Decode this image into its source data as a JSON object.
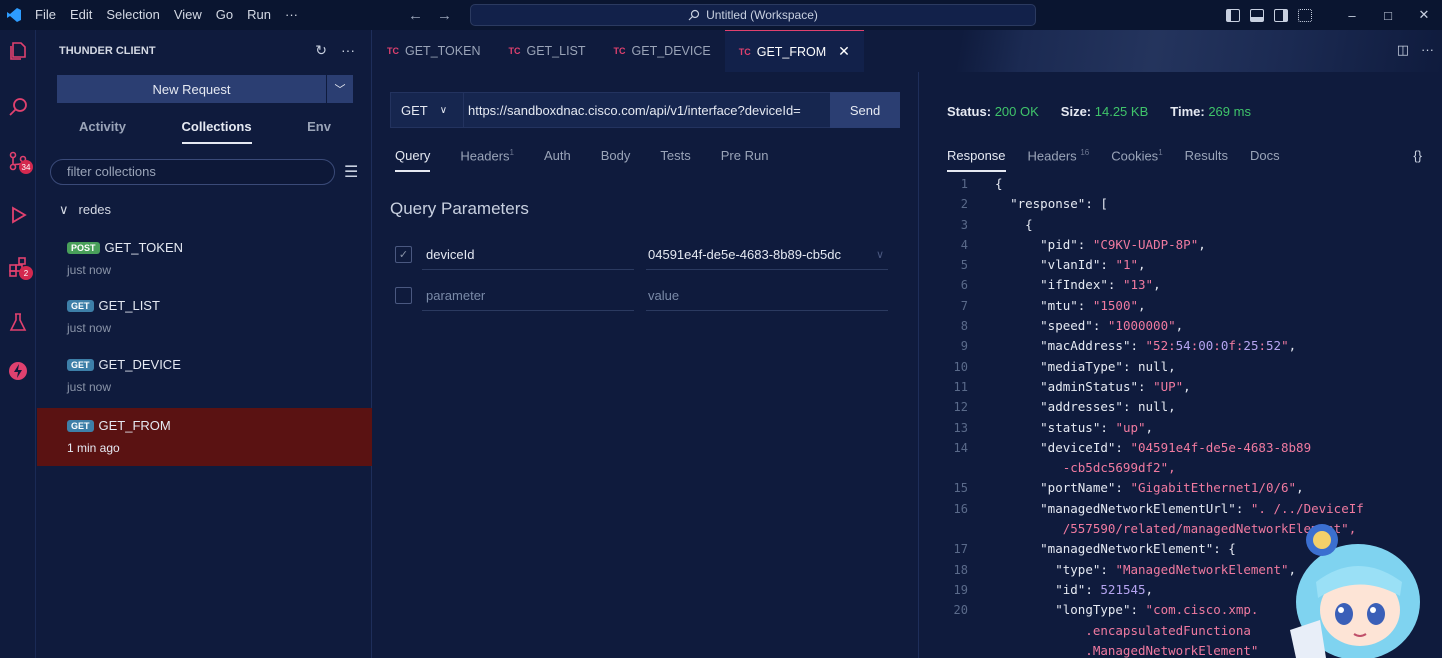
{
  "titlebar": {
    "menu": [
      "File",
      "Edit",
      "Selection",
      "View",
      "Go",
      "Run",
      "···"
    ],
    "command_center": "Untitled (Workspace)",
    "window_buttons": [
      "–",
      "□",
      "✕"
    ]
  },
  "activity_badges": {
    "source_control": "34",
    "extensions": "2"
  },
  "sidebar": {
    "title": "THUNDER CLIENT",
    "new_request": "New Request",
    "tabs": [
      "Activity",
      "Collections",
      "Env"
    ],
    "active_tab": "Collections",
    "filter_placeholder": "filter collections",
    "folder": "redes",
    "requests": [
      {
        "method": "POST",
        "name": "GET_TOKEN",
        "time": "just now"
      },
      {
        "method": "GET",
        "name": "GET_LIST",
        "time": "just now"
      },
      {
        "method": "GET",
        "name": "GET_DEVICE",
        "time": "just now"
      },
      {
        "method": "GET",
        "name": "GET_FROM",
        "time": "1 min ago"
      }
    ]
  },
  "editor_tabs": [
    {
      "prefix": "TC",
      "label": "GET_TOKEN"
    },
    {
      "prefix": "TC",
      "label": "GET_LIST"
    },
    {
      "prefix": "TC",
      "label": "GET_DEVICE"
    },
    {
      "prefix": "TC",
      "label": "GET_FROM"
    }
  ],
  "request": {
    "method": "GET",
    "url": "https://sandboxdnac.cisco.com/api/v1/interface?deviceId=",
    "send_label": "Send",
    "tabs": [
      {
        "label": "Query",
        "count": ""
      },
      {
        "label": "Headers",
        "count": "1"
      },
      {
        "label": "Auth",
        "count": ""
      },
      {
        "label": "Body",
        "count": ""
      },
      {
        "label": "Tests",
        "count": ""
      },
      {
        "label": "Pre Run",
        "count": ""
      }
    ],
    "query_title": "Query Parameters",
    "params": [
      {
        "key": "deviceId",
        "value": "04591e4f-de5e-4683-8b89-cb5dc",
        "checked": true
      },
      {
        "key_placeholder": "parameter",
        "value_placeholder": "value",
        "checked": false
      }
    ]
  },
  "response": {
    "status_label": "Status:",
    "status": "200 OK",
    "size_label": "Size:",
    "size": "14.25 KB",
    "time_label": "Time:",
    "time": "269 ms",
    "tabs": [
      {
        "label": "Response",
        "count": ""
      },
      {
        "label": "Headers",
        "count": "16"
      },
      {
        "label": "Cookies",
        "count": "1"
      },
      {
        "label": "Results",
        "count": ""
      },
      {
        "label": "Docs",
        "count": ""
      }
    ],
    "braces": "{}",
    "lines": [
      {
        "n": "1",
        "text": "{"
      },
      {
        "n": "2",
        "text": "  \"response\": ["
      },
      {
        "n": "3",
        "text": "    {"
      },
      {
        "n": "4",
        "text": "      \"pid\": \"C9KV-UADP-8P\","
      },
      {
        "n": "5",
        "text": "      \"vlanId\": \"1\","
      },
      {
        "n": "6",
        "text": "      \"ifIndex\": \"13\","
      },
      {
        "n": "7",
        "text": "      \"mtu\": \"1500\","
      },
      {
        "n": "8",
        "text": "      \"speed\": \"1000000\","
      },
      {
        "n": "9",
        "text": "      \"macAddress\": \"52:54:00:0f:25:52\","
      },
      {
        "n": "10",
        "text": "      \"mediaType\": null,"
      },
      {
        "n": "11",
        "text": "      \"adminStatus\": \"UP\","
      },
      {
        "n": "12",
        "text": "      \"addresses\": null,"
      },
      {
        "n": "13",
        "text": "      \"status\": \"up\","
      },
      {
        "n": "14",
        "text": "      \"deviceId\": \"04591e4f-de5e-4683-8b89"
      },
      {
        "n": "",
        "text": "         -cb5dc5699df2\","
      },
      {
        "n": "15",
        "text": "      \"portName\": \"GigabitEthernet1/0/6\","
      },
      {
        "n": "16",
        "text": "      \"managedNetworkElementUrl\": \". /../DeviceIf"
      },
      {
        "n": "",
        "text": "         /557590/related/managedNetworkElement\","
      },
      {
        "n": "17",
        "text": "      \"managedNetworkElement\": {"
      },
      {
        "n": "18",
        "text": "        \"type\": \"ManagedNetworkElement\","
      },
      {
        "n": "19",
        "text": "        \"id\": 521545,"
      },
      {
        "n": "20",
        "text": "        \"longType\": \"com.cisco.xmp."
      },
      {
        "n": "",
        "text": "            .encapsulatedFunctiona"
      },
      {
        "n": "",
        "text": "            .ManagedNetworkElement\""
      }
    ]
  }
}
